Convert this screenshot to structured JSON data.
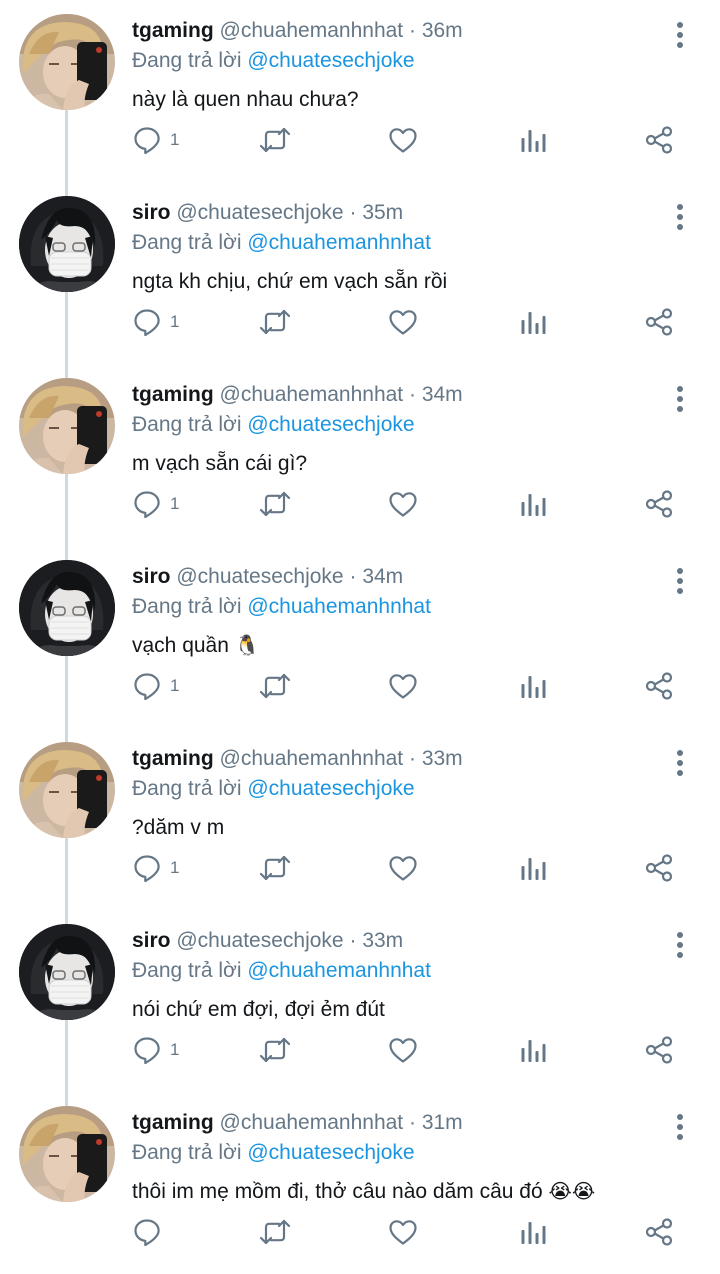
{
  "reply_prefix": "Đang trả lời",
  "icons": {
    "reply": "reply-icon",
    "retweet": "retweet-icon",
    "like": "heart-icon",
    "analytics": "analytics-icon",
    "share": "share-icon",
    "more": "more-vertical-icon"
  },
  "colors": {
    "text": "#14171a",
    "secondary": "#657786",
    "link": "#1b95e0",
    "thread_line": "#cfd9de"
  },
  "tweets": [
    {
      "display_name": "tgaming",
      "handle": "@chuahemanhnhat",
      "time": "36m",
      "reply_to": "@chuatesechjoke",
      "text": "này là quen nhau chưa?",
      "emoji": "",
      "reply_count": "1"
    },
    {
      "display_name": "siro",
      "handle": "@chuatesechjoke",
      "time": "35m",
      "reply_to": "@chuahemanhnhat",
      "text": "ngta kh chịu, chứ em vạch sẵn rồi",
      "emoji": "",
      "reply_count": "1"
    },
    {
      "display_name": "tgaming",
      "handle": "@chuahemanhnhat",
      "time": "34m",
      "reply_to": "@chuatesechjoke",
      "text": "m vạch sẵn cái gì?",
      "emoji": "",
      "reply_count": "1"
    },
    {
      "display_name": "siro",
      "handle": "@chuatesechjoke",
      "time": "34m",
      "reply_to": "@chuahemanhnhat",
      "text": "vạch quần",
      "emoji": "🐧",
      "reply_count": "1"
    },
    {
      "display_name": "tgaming",
      "handle": "@chuahemanhnhat",
      "time": "33m",
      "reply_to": "@chuatesechjoke",
      "text": "?dăm v m",
      "emoji": "",
      "reply_count": "1"
    },
    {
      "display_name": "siro",
      "handle": "@chuatesechjoke",
      "time": "33m",
      "reply_to": "@chuahemanhnhat",
      "text": "nói chứ em đợi, đợi ẻm đút",
      "emoji": "",
      "reply_count": "1"
    },
    {
      "display_name": "tgaming",
      "handle": "@chuahemanhnhat",
      "time": "31m",
      "reply_to": "@chuatesechjoke",
      "text": "thôi im mẹ mồm đi, thở câu nào dăm câu đó",
      "emoji": "😭😭",
      "reply_count": ""
    }
  ]
}
